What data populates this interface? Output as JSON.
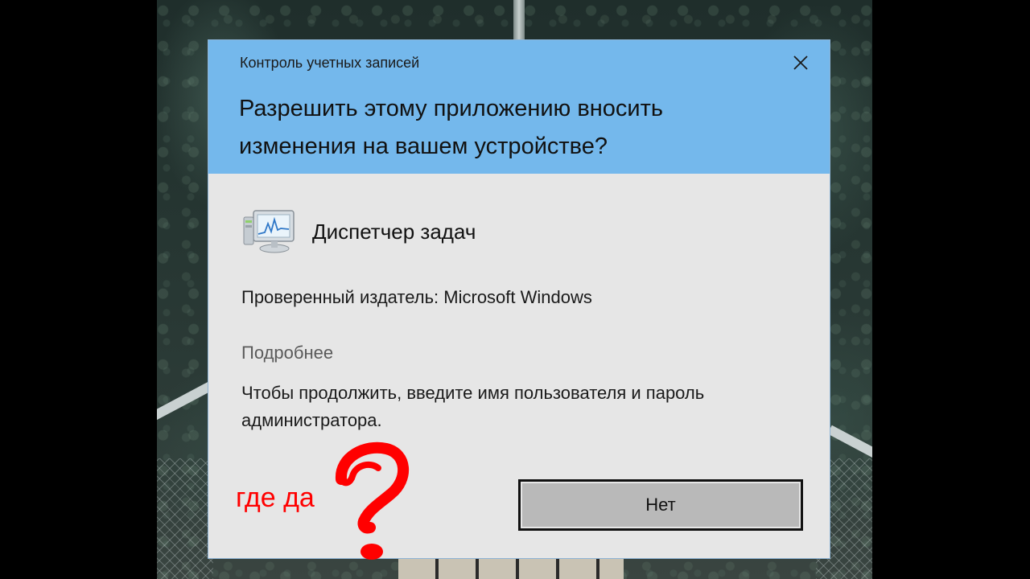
{
  "dialog": {
    "caption": "Контроль учетных записей",
    "question": "Разрешить этому приложению вносить изменения на вашем устройстве?",
    "app_name": "Диспетчер задач",
    "publisher": "Проверенный издатель: Microsoft Windows",
    "more_details": "Подробнее",
    "instruction": "Чтобы продолжить, введите имя пользователя и пароль администратора.",
    "no_button": "Нет",
    "app_icon": "task-manager-icon",
    "close_icon": "close-icon"
  },
  "annotation": {
    "text": "где да",
    "mark": "question-mark",
    "color": "#ff0000"
  },
  "colors": {
    "header": "#74b8ec",
    "body": "#e6e6e6",
    "button": "#b9b9b9"
  }
}
